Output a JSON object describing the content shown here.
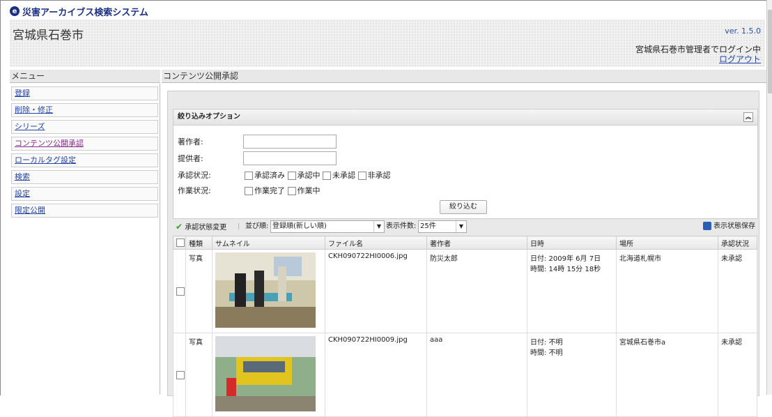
{
  "app": {
    "title": "災害アーカイブス検索システム",
    "logo_icon": "globe-logo-icon"
  },
  "header": {
    "city": "宮城県石巻市",
    "version": "ver. 1.5.0",
    "login_status": "宮城県石巻市管理者でログイン中",
    "logout": "ログアウト"
  },
  "sidebar": {
    "title": "メニュー",
    "items": [
      {
        "label": "登録"
      },
      {
        "label": "削除・修正"
      },
      {
        "label": "シリーズ"
      },
      {
        "label": "コンテンツ公開承認"
      },
      {
        "label": "ローカルタグ設定"
      },
      {
        "label": "検索"
      },
      {
        "label": "設定"
      },
      {
        "label": "限定公開"
      }
    ]
  },
  "main": {
    "title": "コンテンツ公開承認"
  },
  "filter": {
    "title": "絞り込みオプション",
    "author_label": "著作者:",
    "provider_label": "提供者:",
    "approval_label": "承認状況:",
    "approval_options": [
      "承認済み",
      "承認中",
      "未承認",
      "非承認"
    ],
    "work_label": "作業状況:",
    "work_options": [
      "作業完了",
      "作業中"
    ],
    "submit": "絞り込む"
  },
  "toolbar": {
    "change_status": "承認状態変更",
    "sort_label": "並び順:",
    "sort_value": "登録順(新しい順)",
    "count_label": "表示件数:",
    "count_value": "25件",
    "save_view": "表示状態保存"
  },
  "table": {
    "headers": [
      "種類",
      "サムネイル",
      "ファイル名",
      "著作者",
      "日時",
      "場所",
      "承認状況"
    ],
    "rows": [
      {
        "type": "写真",
        "filename": "CKH090722HI0006.jpg",
        "author": "防災太郎",
        "date": "日付: 2009年 6月 7日",
        "time": "時間: 14時 15分 18秒",
        "place": "北海道札幌市",
        "status": "未承認"
      },
      {
        "type": "写真",
        "filename": "CKH090722HI0009.jpg",
        "author": "aaa",
        "date": "日付: 不明",
        "time": "時間: 不明",
        "place": "宮城県石巻市a",
        "status": "未承認"
      }
    ]
  },
  "colors": {
    "brand": "#1a2f86",
    "link": "#2244aa",
    "visited": "#8a2a8a"
  }
}
